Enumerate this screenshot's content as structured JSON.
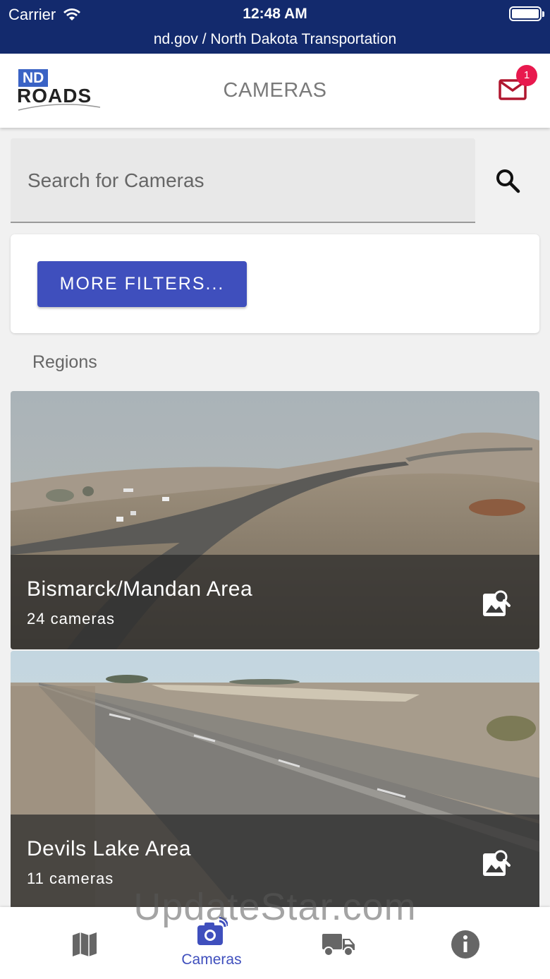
{
  "status_bar": {
    "carrier": "Carrier",
    "time": "12:48 AM",
    "url": "nd.gov / North Dakota Transportation"
  },
  "header": {
    "logo_top": "ND",
    "logo_bottom": "ROADS",
    "title": "CAMERAS",
    "mail_badge_count": "1",
    "mail_icon": "mail-icon"
  },
  "search": {
    "placeholder": "Search for Cameras",
    "value": ""
  },
  "filters": {
    "button_label": "MORE FILTERS..."
  },
  "regions": {
    "label": "Regions",
    "items": [
      {
        "name": "Bismarck/Mandan Area",
        "count": "24 cameras",
        "icon": "image-search-icon"
      },
      {
        "name": "Devils Lake Area",
        "count": "11 cameras",
        "icon": "image-search-icon"
      }
    ]
  },
  "watermark": "UpdateStar.com",
  "bottom_nav": {
    "items": [
      {
        "icon": "map-icon",
        "label": ""
      },
      {
        "icon": "camera-icon",
        "label": "Cameras",
        "active": true
      },
      {
        "icon": "truck-icon",
        "label": ""
      },
      {
        "icon": "info-icon",
        "label": ""
      }
    ]
  },
  "colors": {
    "status_bar_bg": "#132a6d",
    "accent": "#3f4fbd",
    "badge": "#e8194e",
    "mail": "#b0172f"
  }
}
